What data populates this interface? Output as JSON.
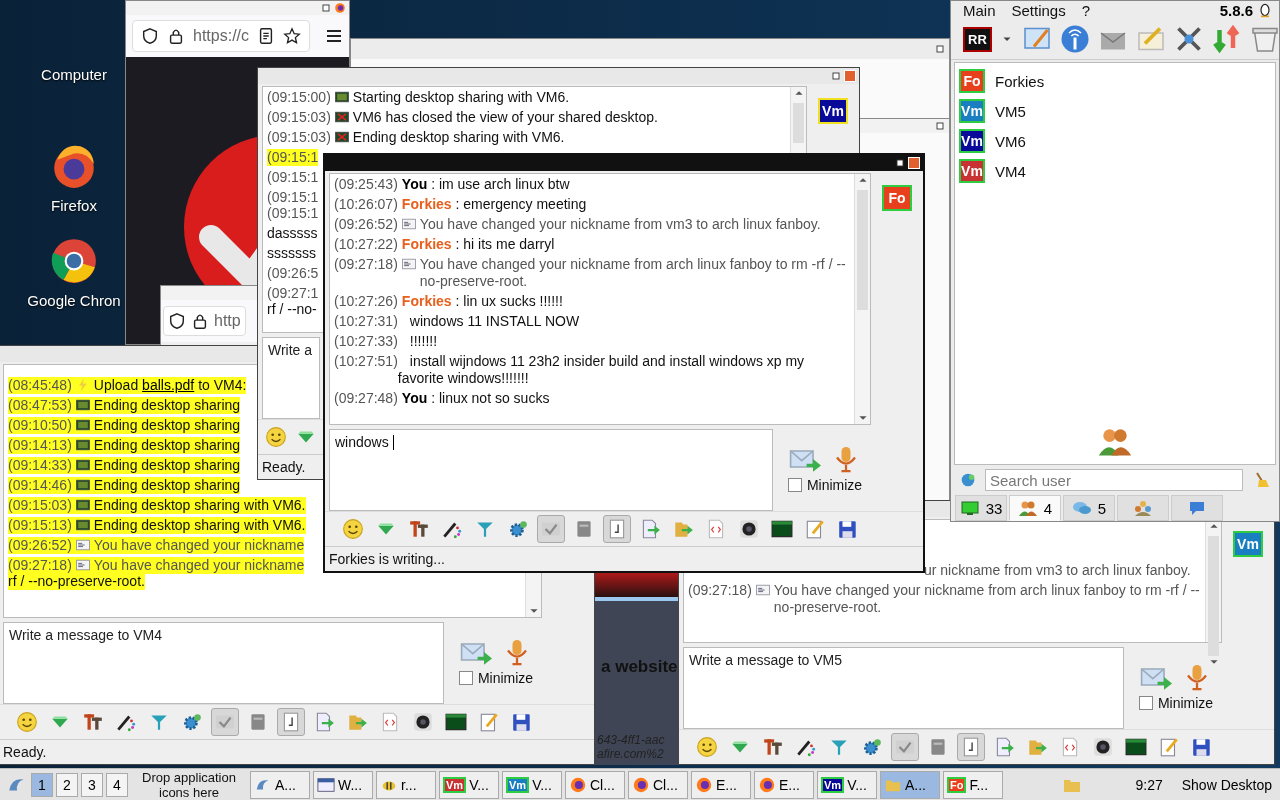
{
  "desktop": {
    "icons": [
      {
        "kind": "computer",
        "label": "Computer"
      },
      {
        "kind": "firefox",
        "label": "Firefox"
      },
      {
        "kind": "chrome",
        "label": "Google Chron"
      }
    ]
  },
  "browsers": [
    {
      "url": "https://c"
    },
    {
      "url": "http"
    }
  ],
  "web_page": {
    "lines": [
      {
        "kind": "heading",
        "text": "a website"
      },
      {
        "kind": "link",
        "text": "643-4ff1-aac"
      },
      {
        "kind": "link",
        "text": "afire.com%2"
      }
    ]
  },
  "chat_windows": [
    {
      "active": false,
      "avatar": {
        "text": "Vm",
        "color": "#0a0a9a",
        "away": true
      },
      "messages": [
        {
          "time": "(09:15:00)",
          "kind": "share",
          "text": "Starting desktop sharing with VM6.",
          "highlighted": false
        },
        {
          "time": "(09:15:03)",
          "kind": "share-closed",
          "text": "VM6 has closed the view of your shared desktop.",
          "highlighted": false
        },
        {
          "time": "(09:15:03)",
          "kind": "share-closed",
          "text": "Ending desktop sharing with VM6.",
          "highlighted": false
        },
        {
          "time": "(09:15:1",
          "kind": "plain",
          "highlighted": true
        },
        {
          "time": "(09:15:1",
          "kind": "plain",
          "highlighted": false
        },
        {
          "time": "(09:15:1",
          "kind": "plain",
          "highlighted": false
        },
        {
          "time": "(09:15:1",
          "kind": "wrap",
          "highlighted": false
        },
        {
          "text": "dasssss",
          "kind": "plain",
          "highlighted": false
        },
        {
          "text": "sssssss",
          "kind": "plain",
          "highlighted": false
        },
        {
          "time": "(09:26:5",
          "kind": "plain",
          "highlighted": false
        },
        {
          "time": "(09:27:1",
          "kind": "plain",
          "highlighted": false
        },
        {
          "text": "rf / --no-",
          "kind": "wrap",
          "highlighted": false
        }
      ],
      "input": {
        "placeholder": "Write a"
      },
      "toolbar": [
        {
          "kind": "smiley",
          "pressed": false
        },
        {
          "kind": "gem",
          "pressed": false
        }
      ],
      "status": "Ready."
    },
    {
      "active": false,
      "messages": [
        {
          "time": "(08:45:48)",
          "kind": "upload",
          "text": "Upload ",
          "link": "balls.pdf",
          "after": " to VM4:",
          "highlighted": true
        },
        {
          "time": "(08:47:53)",
          "kind": "share",
          "text": "Ending desktop sharing",
          "highlighted": true
        },
        {
          "time": "(09:10:50)",
          "kind": "share",
          "text": "Ending desktop sharing",
          "highlighted": true
        },
        {
          "time": "(09:14:13)",
          "kind": "share",
          "text": "Ending desktop sharing",
          "highlighted": true
        },
        {
          "time": "(09:14:33)",
          "kind": "share",
          "text": "Ending desktop sharing",
          "highlighted": true
        },
        {
          "time": "(09:14:46)",
          "kind": "share",
          "text": "Ending desktop sharing",
          "highlighted": true
        },
        {
          "time": "(09:15:03)",
          "kind": "share",
          "text": "Ending desktop sharing with VM6.",
          "highlighted": true
        },
        {
          "time": "(09:15:13)",
          "kind": "share",
          "text": "Ending desktop sharing with VM6.",
          "highlighted": true
        },
        {
          "time": "(09:26:52)",
          "kind": "nick",
          "text": "You have changed your nickname",
          "highlighted": true
        },
        {
          "time": "(09:27:18)",
          "kind": "nick",
          "text": "You have changed your nickname",
          "highlighted": true
        },
        {
          "text": "rf / --no-preserve-root.",
          "kind": "wrap",
          "highlighted": true
        }
      ],
      "input": {
        "placeholder": "Write a message to VM4"
      },
      "minimize": {
        "label": "Minimize",
        "checked": false
      },
      "toolbar": [
        {
          "kind": "smiley",
          "pressed": false
        },
        {
          "kind": "gem",
          "pressed": false
        },
        {
          "kind": "font",
          "pressed": false
        },
        {
          "kind": "pen",
          "pressed": false
        },
        {
          "kind": "funnel",
          "pressed": false
        },
        {
          "kind": "gear",
          "pressed": false
        },
        {
          "kind": "spellcheck",
          "pressed": true
        },
        {
          "kind": "book",
          "pressed": false
        },
        {
          "kind": "note",
          "pressed": true
        },
        {
          "kind": "file-send",
          "pressed": false
        },
        {
          "kind": "folder-send",
          "pressed": false
        },
        {
          "kind": "code",
          "pressed": false
        },
        {
          "kind": "webcam",
          "pressed": false
        },
        {
          "kind": "terminal",
          "pressed": false
        },
        {
          "kind": "notepad",
          "pressed": false
        },
        {
          "kind": "floppy",
          "pressed": false
        }
      ],
      "status": "Ready."
    },
    {
      "active": false,
      "avatar": {
        "text": "Vm",
        "color": "#1a7fc0",
        "away": false
      },
      "messages": [
        {
          "kind": "fragment",
          "text": "ur nickname from vm3 to arch linux fanboy."
        },
        {
          "time": "(09:27:18)",
          "kind": "nick",
          "text": "You have changed your nickname from arch linux fanboy to rm -rf / --no-preserve-root."
        }
      ],
      "input": {
        "placeholder": "Write a message to VM5"
      },
      "minimize": {
        "label": "Minimize",
        "checked": false
      },
      "toolbar": [
        {
          "kind": "smiley",
          "pressed": false
        },
        {
          "kind": "gem",
          "pressed": false
        },
        {
          "kind": "font",
          "pressed": false
        },
        {
          "kind": "pen",
          "pressed": false
        },
        {
          "kind": "funnel",
          "pressed": false
        },
        {
          "kind": "gear",
          "pressed": false
        },
        {
          "kind": "spellcheck",
          "pressed": true
        },
        {
          "kind": "book",
          "pressed": false
        },
        {
          "kind": "note",
          "pressed": true
        },
        {
          "kind": "file-send",
          "pressed": false
        },
        {
          "kind": "folder-send",
          "pressed": false
        },
        {
          "kind": "code",
          "pressed": false
        },
        {
          "kind": "webcam",
          "pressed": false
        },
        {
          "kind": "terminal",
          "pressed": false
        },
        {
          "kind": "notepad",
          "pressed": false
        },
        {
          "kind": "floppy",
          "pressed": false
        }
      ]
    },
    {
      "active": true,
      "avatar": {
        "text": "Fo",
        "color": "#e8401c",
        "away": false
      },
      "messages": [
        {
          "time": "(09:25:43)",
          "kind": "chat",
          "sender": "You",
          "self": true,
          "text": ": im use arch linux btw"
        },
        {
          "time": "(10:26:07)",
          "kind": "chat",
          "sender": "Forkies",
          "self": false,
          "text": ": emergency meeting"
        },
        {
          "time": "(09:26:52)",
          "kind": "nick",
          "text": "You have changed your nickname from vm3 to arch linux fanboy."
        },
        {
          "time": "(10:27:22)",
          "kind": "chat",
          "sender": "Forkies",
          "self": false,
          "text": ": hi its me darryl"
        },
        {
          "time": "(09:27:18)",
          "kind": "nick",
          "text": "You have changed your nickname from arch linux fanboy to rm -rf / --no-preserve-root."
        },
        {
          "time": "(10:27:26)",
          "kind": "chat",
          "sender": "Forkies",
          "self": false,
          "text": ": lin ux sucks !!!!!!"
        },
        {
          "time": "(10:27:31)",
          "kind": "plain",
          "text": "windows 11 INSTALL NOW"
        },
        {
          "time": "(10:27:33)",
          "kind": "plain",
          "text": "!!!!!!!"
        },
        {
          "time": "(10:27:51)",
          "kind": "plain",
          "text": "install wijndows 11 23h2 insider build and install windows xp my favorite windows!!!!!!!"
        },
        {
          "time": "(09:27:48)",
          "kind": "chat",
          "sender": "You",
          "self": true,
          "text": ": linux not so sucks"
        }
      ],
      "input": {
        "value": "windows"
      },
      "minimize": {
        "label": "Minimize",
        "checked": false
      },
      "toolbar": [
        {
          "kind": "smiley",
          "pressed": false
        },
        {
          "kind": "gem",
          "pressed": false
        },
        {
          "kind": "font",
          "pressed": false
        },
        {
          "kind": "pen",
          "pressed": false
        },
        {
          "kind": "funnel",
          "pressed": false
        },
        {
          "kind": "gear",
          "pressed": false
        },
        {
          "kind": "spellcheck",
          "pressed": true
        },
        {
          "kind": "book",
          "pressed": false
        },
        {
          "kind": "note",
          "pressed": true
        },
        {
          "kind": "file-send",
          "pressed": false
        },
        {
          "kind": "folder-send",
          "pressed": false
        },
        {
          "kind": "code",
          "pressed": false
        },
        {
          "kind": "webcam",
          "pressed": false
        },
        {
          "kind": "terminal",
          "pressed": false
        },
        {
          "kind": "notepad",
          "pressed": false
        },
        {
          "kind": "floppy",
          "pressed": false
        }
      ],
      "status": "Forkies is writing..."
    }
  ],
  "contacts": {
    "menu": [
      "Main",
      "Settings",
      "?"
    ],
    "version": "5.8.6",
    "toolbar": [
      {
        "kind": "logo",
        "label": "RR"
      },
      {
        "kind": "caret"
      },
      {
        "kind": "card-edit"
      },
      {
        "kind": "antenna"
      },
      {
        "kind": "envelope"
      },
      {
        "kind": "envelope-edit"
      },
      {
        "kind": "tools"
      },
      {
        "kind": "transfer"
      },
      {
        "kind": "box"
      }
    ],
    "users": [
      {
        "badge": "Fo",
        "name": "Forkies",
        "color": "#e8401c"
      },
      {
        "badge": "Vm",
        "name": "VM5",
        "color": "#1a7fc0"
      },
      {
        "badge": "Vm",
        "name": "VM6",
        "color": "#0a0a9a"
      },
      {
        "badge": "Vm",
        "name": "VM4",
        "color": "#c83232"
      }
    ],
    "search": {
      "placeholder": "Search user"
    },
    "tabs": [
      {
        "kind": "computers",
        "count": "33",
        "selected": false
      },
      {
        "kind": "users",
        "count": "4",
        "selected": true
      },
      {
        "kind": "chats",
        "count": "5",
        "selected": false
      },
      {
        "kind": "groups",
        "selected": false
      },
      {
        "kind": "transfers",
        "selected": false
      }
    ]
  },
  "taskbar": {
    "workspaces": [
      {
        "label": "1",
        "selected": true
      },
      {
        "label": "2",
        "selected": false
      },
      {
        "label": "3",
        "selected": false
      },
      {
        "label": "4",
        "selected": false
      }
    ],
    "drop_hint": "Drop application icons here",
    "tasks": [
      {
        "kind": "shell",
        "label": "A...",
        "selected": false
      },
      {
        "kind": "window",
        "label": "W...",
        "selected": false
      },
      {
        "kind": "bee",
        "label": "r...",
        "selected": false
      },
      {
        "kind": "avatar",
        "badge": "Vm",
        "color": "#c83232",
        "label": "V...",
        "selected": false
      },
      {
        "kind": "avatar",
        "badge": "Vm",
        "color": "#1a7fc0",
        "label": "V...",
        "selected": false
      },
      {
        "kind": "firefox",
        "label": "Cl...",
        "selected": false
      },
      {
        "kind": "firefox",
        "label": "Cl...",
        "selected": false
      },
      {
        "kind": "firefox",
        "label": "E...",
        "selected": false
      },
      {
        "kind": "firefox",
        "label": "E...",
        "selected": false
      },
      {
        "kind": "avatar",
        "badge": "Vm",
        "color": "#0a0a9a",
        "label": "V...",
        "selected": false
      },
      {
        "kind": "folder",
        "label": "A...",
        "selected": true
      },
      {
        "kind": "avatar",
        "badge": "Fo",
        "color": "#e8401c",
        "label": "F...",
        "selected": false
      }
    ],
    "clock": "9:27",
    "show_desktop": "Show Desktop"
  }
}
